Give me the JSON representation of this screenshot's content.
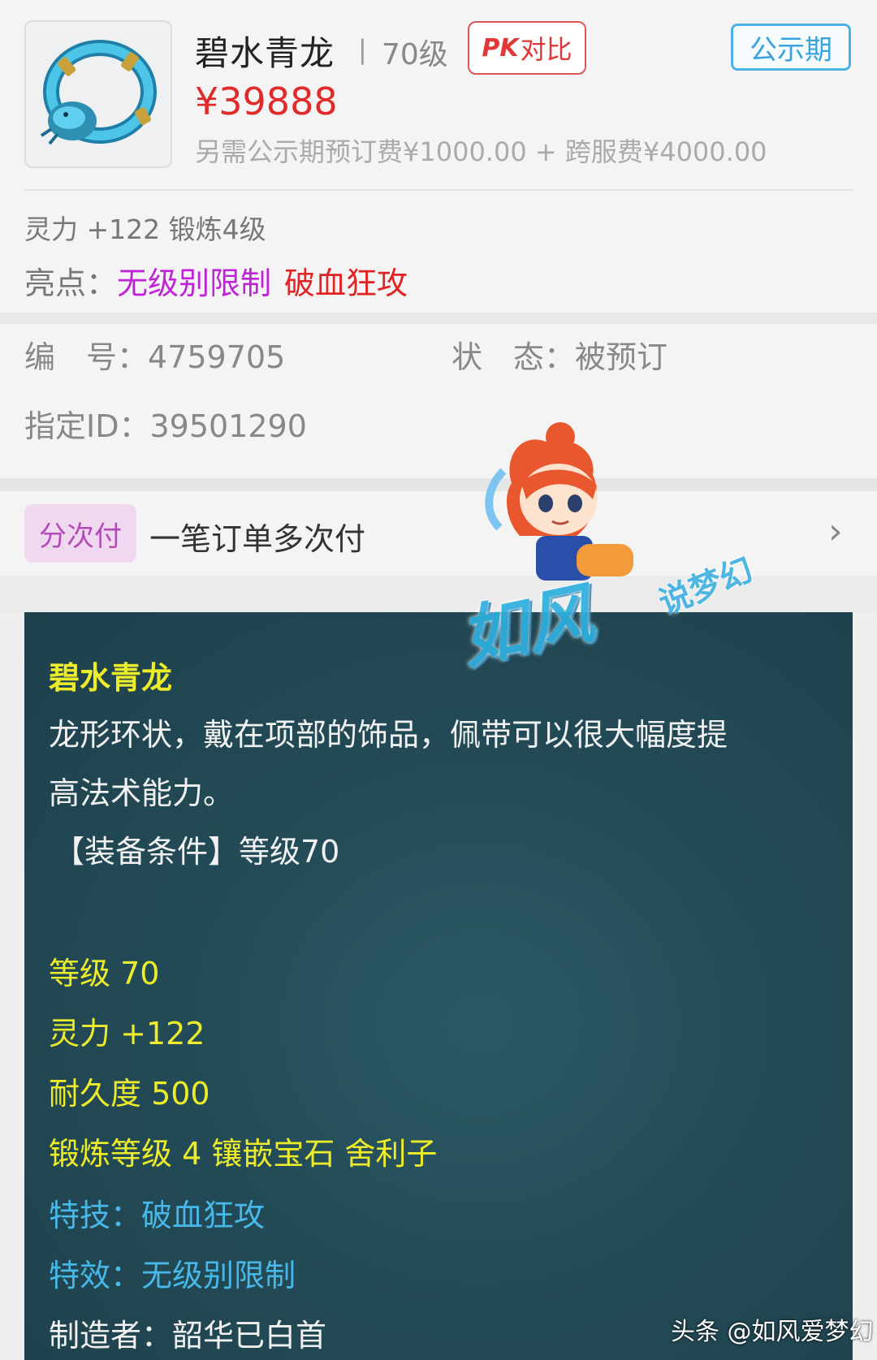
{
  "item": {
    "name": "碧水青龙",
    "level": "70级",
    "pk_label": "对比",
    "pk_prefix": "PK",
    "period_badge": "公示期",
    "price": "¥39888",
    "fee_note": "另需公示期预订费¥1000.00 + 跨服费¥4000.00",
    "attr_line": "灵力 +122 锻炼4级",
    "highlights_label": "亮点：",
    "highlights": [
      "无级别限制",
      "破血狂攻"
    ]
  },
  "info": {
    "id_label": "编　号：",
    "id_value": "4759705",
    "status_label": "状　态：",
    "status_value": "被预订",
    "assigned_label": "指定ID：",
    "assigned_value": "39501290"
  },
  "installment": {
    "tag": "分次付",
    "text": "一笔订单多次付",
    "chevron": "chevron-right-icon"
  },
  "description": {
    "title": "碧水青龙",
    "desc_line1": "龙形环状，戴在项部的饰品，佩带可以很大幅度提",
    "desc_line2": "高法术能力。",
    "condition": "【装备条件】等级70",
    "stats": [
      "等级 70",
      "灵力 +122",
      "耐久度 500",
      "锻炼等级 4 镶嵌宝石 舍利子"
    ],
    "skill": "特技：破血狂攻",
    "effect": "特效：无级别限制",
    "maker": "制造者：韶华已白首"
  },
  "watermark": {
    "main": "如风",
    "sub": "说梦幻",
    "footer": "头条 @如风爱梦幻"
  },
  "colors": {
    "price_red": "#e12b2b",
    "highlight_purple": "#c023d6",
    "highlight_red": "#e02323",
    "panel_bg": "#234b57",
    "panel_yellow": "#ecec2a",
    "panel_blue": "#47b8e8"
  }
}
